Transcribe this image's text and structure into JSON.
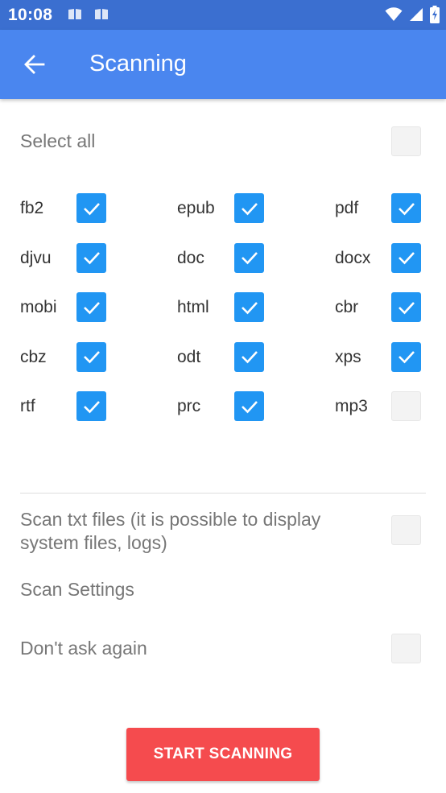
{
  "status_bar": {
    "time": "10:08",
    "left_icons": [
      "book-icon",
      "book-icon"
    ],
    "right_icons": [
      "wifi-icon",
      "signal-icon",
      "battery-icon"
    ]
  },
  "app_bar": {
    "title": "Scanning",
    "back_icon": "arrow-left-icon",
    "color": "#4a86ef"
  },
  "select_all": {
    "label": "Select all",
    "checked": false
  },
  "formats": [
    {
      "label": "fb2",
      "checked": true
    },
    {
      "label": "epub",
      "checked": true
    },
    {
      "label": "pdf",
      "checked": true
    },
    {
      "label": "djvu",
      "checked": true
    },
    {
      "label": "doc",
      "checked": true
    },
    {
      "label": "docx",
      "checked": true
    },
    {
      "label": "mobi",
      "checked": true
    },
    {
      "label": "html",
      "checked": true
    },
    {
      "label": "cbr",
      "checked": true
    },
    {
      "label": "cbz",
      "checked": true
    },
    {
      "label": "odt",
      "checked": true
    },
    {
      "label": "xps",
      "checked": true
    },
    {
      "label": "rtf",
      "checked": true
    },
    {
      "label": "prc",
      "checked": true
    },
    {
      "label": "mp3",
      "checked": false
    }
  ],
  "scan_txt": {
    "label": "Scan txt files (it is possible to display system files, logs)",
    "checked": false
  },
  "scan_settings": {
    "label": "Scan Settings"
  },
  "dont_ask": {
    "label": "Don't ask again",
    "checked": false
  },
  "start_button": {
    "label": "START SCANNING",
    "color": "#f54b4e"
  },
  "checkbox_color": "#2196f3"
}
